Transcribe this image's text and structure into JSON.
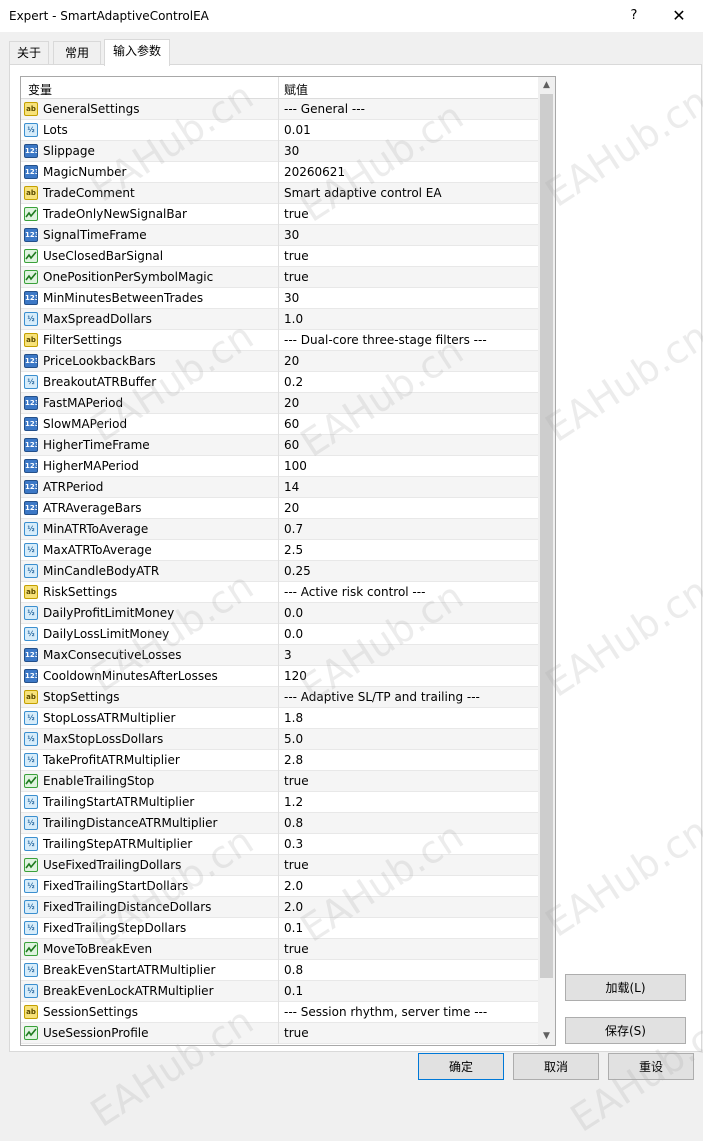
{
  "window": {
    "title": "Expert - SmartAdaptiveControlEA",
    "help_label": "?",
    "close_label": "✕"
  },
  "tabs": [
    {
      "label": "关于",
      "active": false
    },
    {
      "label": "常用",
      "active": false
    },
    {
      "label": "输入参数",
      "active": true
    }
  ],
  "grid": {
    "headers": {
      "variable": "变量",
      "value": "赋值"
    },
    "rows": [
      {
        "type": "string",
        "name": "GeneralSettings",
        "value": "--- General ---"
      },
      {
        "type": "double",
        "name": "Lots",
        "value": "0.01"
      },
      {
        "type": "int",
        "name": "Slippage",
        "value": "30"
      },
      {
        "type": "int",
        "name": "MagicNumber",
        "value": "20260621"
      },
      {
        "type": "string",
        "name": "TradeComment",
        "value": "Smart adaptive control EA"
      },
      {
        "type": "bool",
        "name": "TradeOnlyNewSignalBar",
        "value": "true"
      },
      {
        "type": "int",
        "name": "SignalTimeFrame",
        "value": "30"
      },
      {
        "type": "bool",
        "name": "UseClosedBarSignal",
        "value": "true"
      },
      {
        "type": "bool",
        "name": "OnePositionPerSymbolMagic",
        "value": "true"
      },
      {
        "type": "int",
        "name": "MinMinutesBetweenTrades",
        "value": "30"
      },
      {
        "type": "double",
        "name": "MaxSpreadDollars",
        "value": "1.0"
      },
      {
        "type": "string",
        "name": "FilterSettings",
        "value": "--- Dual-core three-stage filters ---"
      },
      {
        "type": "int",
        "name": "PriceLookbackBars",
        "value": "20"
      },
      {
        "type": "double",
        "name": "BreakoutATRBuffer",
        "value": "0.2"
      },
      {
        "type": "int",
        "name": "FastMAPeriod",
        "value": "20"
      },
      {
        "type": "int",
        "name": "SlowMAPeriod",
        "value": "60"
      },
      {
        "type": "int",
        "name": "HigherTimeFrame",
        "value": "60"
      },
      {
        "type": "int",
        "name": "HigherMAPeriod",
        "value": "100"
      },
      {
        "type": "int",
        "name": "ATRPeriod",
        "value": "14"
      },
      {
        "type": "int",
        "name": "ATRAverageBars",
        "value": "20"
      },
      {
        "type": "double",
        "name": "MinATRToAverage",
        "value": "0.7"
      },
      {
        "type": "double",
        "name": "MaxATRToAverage",
        "value": "2.5"
      },
      {
        "type": "double",
        "name": "MinCandleBodyATR",
        "value": "0.25"
      },
      {
        "type": "string",
        "name": "RiskSettings",
        "value": "--- Active risk control ---"
      },
      {
        "type": "double",
        "name": "DailyProfitLimitMoney",
        "value": "0.0"
      },
      {
        "type": "double",
        "name": "DailyLossLimitMoney",
        "value": "0.0"
      },
      {
        "type": "int",
        "name": "MaxConsecutiveLosses",
        "value": "3"
      },
      {
        "type": "int",
        "name": "CooldownMinutesAfterLosses",
        "value": "120"
      },
      {
        "type": "string",
        "name": "StopSettings",
        "value": "--- Adaptive SL/TP and trailing ---"
      },
      {
        "type": "double",
        "name": "StopLossATRMultiplier",
        "value": "1.8"
      },
      {
        "type": "double",
        "name": "MaxStopLossDollars",
        "value": "5.0"
      },
      {
        "type": "double",
        "name": "TakeProfitATRMultiplier",
        "value": "2.8"
      },
      {
        "type": "bool",
        "name": "EnableTrailingStop",
        "value": "true"
      },
      {
        "type": "double",
        "name": "TrailingStartATRMultiplier",
        "value": "1.2"
      },
      {
        "type": "double",
        "name": "TrailingDistanceATRMultiplier",
        "value": "0.8"
      },
      {
        "type": "double",
        "name": "TrailingStepATRMultiplier",
        "value": "0.3"
      },
      {
        "type": "bool",
        "name": "UseFixedTrailingDollars",
        "value": "true"
      },
      {
        "type": "double",
        "name": "FixedTrailingStartDollars",
        "value": "2.0"
      },
      {
        "type": "double",
        "name": "FixedTrailingDistanceDollars",
        "value": "2.0"
      },
      {
        "type": "double",
        "name": "FixedTrailingStepDollars",
        "value": "0.1"
      },
      {
        "type": "bool",
        "name": "MoveToBreakEven",
        "value": "true"
      },
      {
        "type": "double",
        "name": "BreakEvenStartATRMultiplier",
        "value": "0.8"
      },
      {
        "type": "double",
        "name": "BreakEvenLockATRMultiplier",
        "value": "0.1"
      },
      {
        "type": "string",
        "name": "SessionSettings",
        "value": "--- Session rhythm, server time ---"
      },
      {
        "type": "bool",
        "name": "UseSessionProfile",
        "value": "true"
      }
    ],
    "icon_glyphs": {
      "string": "ab",
      "double": "½",
      "int": "123"
    }
  },
  "buttons": {
    "load": "加载(L)",
    "save": "保存(S)",
    "ok": "确定",
    "cancel": "取消",
    "reset": "重设"
  },
  "watermark": {
    "text": "EAHub.cn"
  },
  "colors": {
    "accent": "#0078d7",
    "string_icon": "#f7e27a",
    "double_icon": "#d6ecfa",
    "int_icon": "#3c78c6",
    "bool_icon": "#dff3df"
  }
}
